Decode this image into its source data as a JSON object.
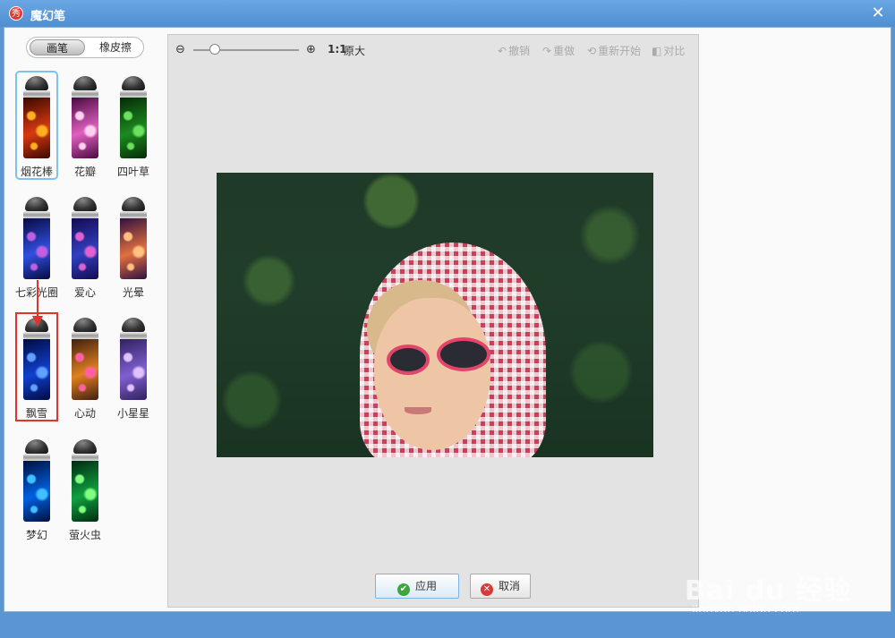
{
  "window": {
    "title": "魔幻笔",
    "app_icon": "秀",
    "close_glyph": "✕"
  },
  "mode_switch": {
    "brush_label": "画笔",
    "eraser_label": "橡皮擦",
    "active": "brush"
  },
  "brushes": [
    {
      "label": "烟花棒",
      "colors": [
        "#3a0800",
        "#d83a10",
        "#ffb020"
      ],
      "selected": true
    },
    {
      "label": "花瓣",
      "colors": [
        "#4a0a40",
        "#e060c0",
        "#ffd0f0"
      ]
    },
    {
      "label": "四叶草",
      "colors": [
        "#062a06",
        "#1c8a20",
        "#6ee060"
      ]
    },
    {
      "label": "七彩光圈",
      "colors": [
        "#080a40",
        "#3050e0",
        "#c060e0"
      ]
    },
    {
      "label": "爱心",
      "colors": [
        "#140a50",
        "#3040c0",
        "#e060d0"
      ]
    },
    {
      "label": "光晕",
      "colors": [
        "#301040",
        "#e07040",
        "#ffc080"
      ]
    },
    {
      "label": "飘雪",
      "colors": [
        "#020a40",
        "#1040d0",
        "#60a0ff"
      ],
      "highlighted": true
    },
    {
      "label": "心动",
      "colors": [
        "#402010",
        "#e08020",
        "#ff60a0"
      ]
    },
    {
      "label": "小星星",
      "colors": [
        "#302060",
        "#8060d0",
        "#e0c0ff"
      ]
    },
    {
      "label": "梦幻",
      "colors": [
        "#001040",
        "#0060e0",
        "#40c0ff"
      ]
    },
    {
      "label": "萤火虫",
      "colors": [
        "#012a10",
        "#10a040",
        "#80ff80"
      ]
    }
  ],
  "toolbar": {
    "zoom_out_icon": "zoom-out-icon",
    "zoom_in_icon": "zoom-in-icon",
    "zoom_level": 0.2,
    "ratio_label": "1:1",
    "original_label": "原大",
    "undo_label": "撤销",
    "redo_label": "重做",
    "restart_label": "重新开始",
    "compare_label": "对比"
  },
  "actions": {
    "apply_label": "应用",
    "cancel_label": "取消"
  },
  "watermark": {
    "logo": "Bai du 经验",
    "sub": "jingyan.baidu.com"
  }
}
